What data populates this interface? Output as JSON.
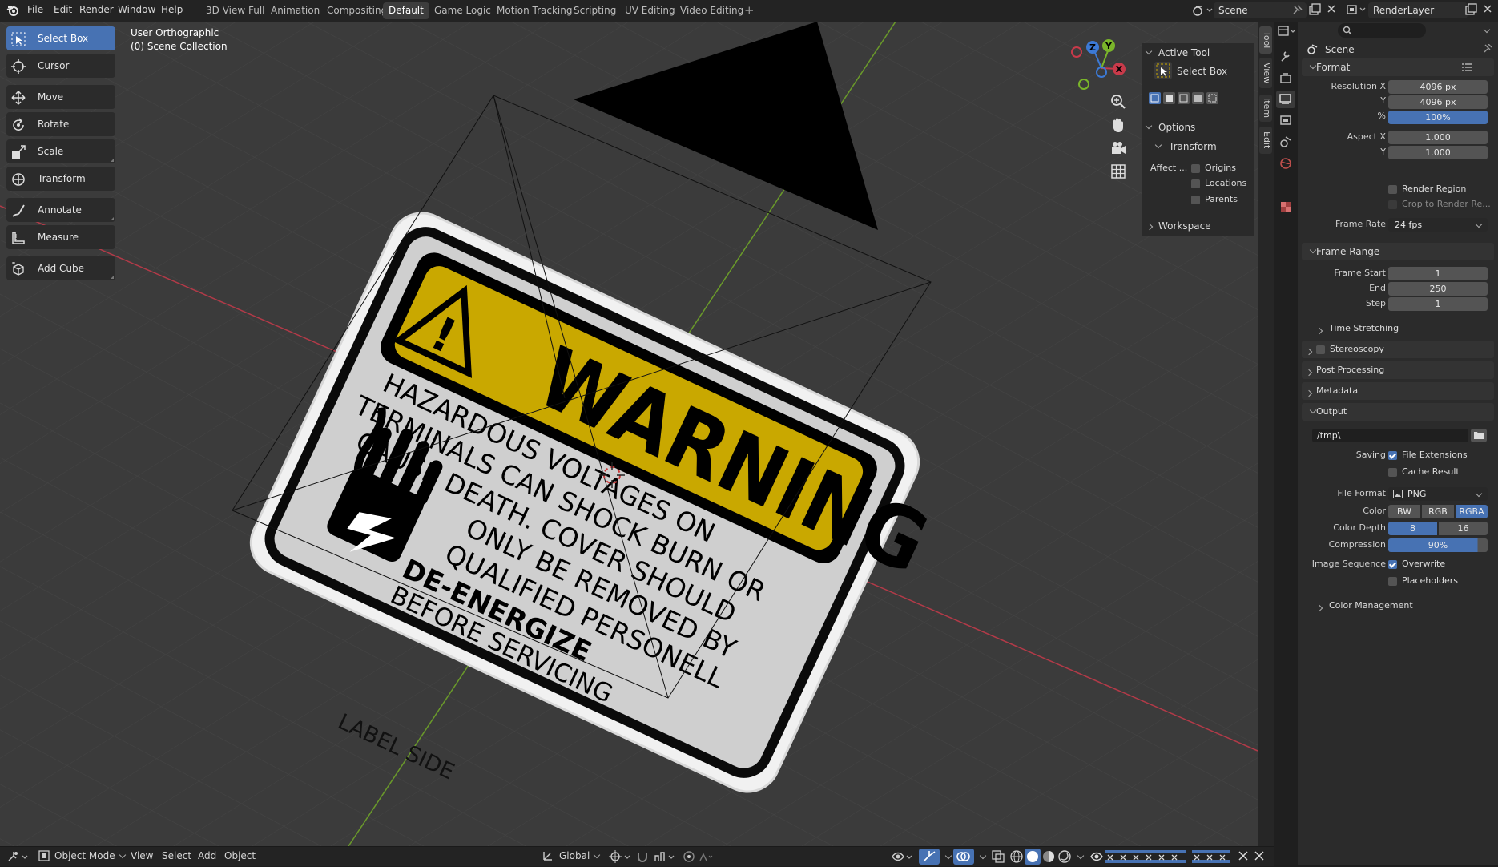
{
  "topbar": {
    "menus": [
      "File",
      "Edit",
      "Render",
      "Window",
      "Help"
    ],
    "workspaces": [
      "3D View Full",
      "Animation",
      "Compositing",
      "Default",
      "Game Logic",
      "Motion Tracking",
      "Scripting",
      "UV Editing",
      "Video Editing"
    ],
    "active_workspace": "Default",
    "add_tab": "+",
    "scene": "Scene",
    "render_layer": "RenderLayer"
  },
  "viewport": {
    "view_name": "User Orthographic",
    "collection": "(0) Scene Collection",
    "sign": {
      "title": "WARNING",
      "line1": "HAZARDOUS VOLTAGES ON",
      "line2": "TERMINALS CAN SHOCK BURN OR",
      "line3": "CAUSE DEATH. COVER SHOULD",
      "line4": "ONLY BE REMOVED BY",
      "line5": "QUALIFIED PERSONELL",
      "line6": "DE-ENERGIZE",
      "line7": "BEFORE SERVICING",
      "label_side": "LABEL SIDE"
    },
    "gizmo": {
      "x": "X",
      "y": "Y",
      "z": "Z"
    }
  },
  "tools": [
    {
      "label": "Select Box",
      "icon": "select-box-icon",
      "active": true
    },
    {
      "label": "Cursor",
      "icon": "cursor-icon",
      "active": false
    },
    {
      "label": "Move",
      "icon": "move-icon",
      "active": false
    },
    {
      "label": "Rotate",
      "icon": "rotate-icon",
      "active": false
    },
    {
      "label": "Scale",
      "icon": "scale-icon",
      "active": false
    },
    {
      "label": "Transform",
      "icon": "transform-icon",
      "active": false
    },
    {
      "label": "Annotate",
      "icon": "annotate-icon",
      "active": false
    },
    {
      "label": "Measure",
      "icon": "measure-icon",
      "active": false
    },
    {
      "label": "Add Cube",
      "icon": "add-cube-icon",
      "active": false
    }
  ],
  "npanel": {
    "active_tool_header": "Active Tool",
    "active_tool_name": "Select Box",
    "options_header": "Options",
    "transform_header": "Transform",
    "affect_label": "Affect ...",
    "origins": "Origins",
    "locations": "Locations",
    "parents": "Parents",
    "workspace_header": "Workspace",
    "tabs": [
      "Tool",
      "View",
      "Item",
      "Edit"
    ]
  },
  "properties": {
    "context": "Scene",
    "format": {
      "header": "Format",
      "resolution_x_label": "Resolution X",
      "resolution_x": "4096 px",
      "resolution_y_label": "Y",
      "resolution_y": "4096 px",
      "percent_label": "%",
      "percent": "100%",
      "aspect_x_label": "Aspect X",
      "aspect_x": "1.000",
      "aspect_y_label": "Y",
      "aspect_y": "1.000",
      "render_region": "Render Region",
      "crop": "Crop to Render Re...",
      "frame_rate_label": "Frame Rate",
      "frame_rate": "24 fps"
    },
    "frame_range": {
      "header": "Frame Range",
      "start_label": "Frame Start",
      "start": "1",
      "end_label": "End",
      "end": "250",
      "step_label": "Step",
      "step": "1",
      "time_stretching": "Time Stretching"
    },
    "stereoscopy": "Stereoscopy",
    "post_processing": "Post Processing",
    "metadata": "Metadata",
    "output": {
      "header": "Output",
      "path": "/tmp\\",
      "saving_label": "Saving",
      "file_extensions": "File Extensions",
      "cache_result": "Cache Result",
      "file_format_label": "File Format",
      "file_format": "PNG",
      "color_label": "Color",
      "color_options": [
        "BW",
        "RGB",
        "RGBA"
      ],
      "color_selected": "RGBA",
      "depth_label": "Color Depth",
      "depth_options": [
        "8",
        "16"
      ],
      "depth_selected": "8",
      "compression_label": "Compression",
      "compression": "90%",
      "image_sequence_label": "Image Sequence",
      "overwrite": "Overwrite",
      "placeholders": "Placeholders",
      "color_management": "Color Management"
    }
  },
  "bottombar": {
    "mode": "Object Mode",
    "menus": [
      "View",
      "Select",
      "Add",
      "Object"
    ],
    "orientation": "Global"
  },
  "colors": {
    "accent": "#4772b3",
    "sign_yellow": "#c9a800",
    "axis_x": "#c83a4a",
    "axis_y": "#7ab52a"
  }
}
